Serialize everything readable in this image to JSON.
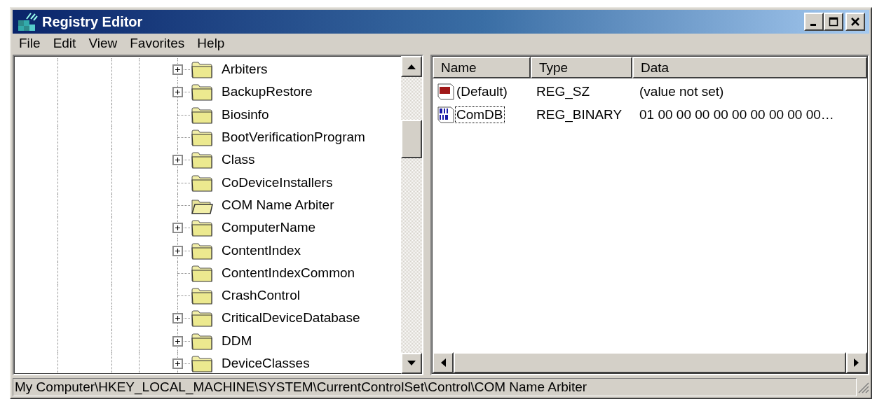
{
  "window": {
    "title": "Registry Editor"
  },
  "menu": [
    "File",
    "Edit",
    "View",
    "Favorites",
    "Help"
  ],
  "tree": {
    "items": [
      {
        "label": "Arbiters",
        "expandable": true,
        "open": false
      },
      {
        "label": "BackupRestore",
        "expandable": true,
        "open": false
      },
      {
        "label": "Biosinfo",
        "expandable": false,
        "open": false
      },
      {
        "label": "BootVerificationProgram",
        "expandable": false,
        "open": false
      },
      {
        "label": "Class",
        "expandable": true,
        "open": false
      },
      {
        "label": "CoDeviceInstallers",
        "expandable": false,
        "open": false
      },
      {
        "label": "COM Name Arbiter",
        "expandable": false,
        "open": true
      },
      {
        "label": "ComputerName",
        "expandable": true,
        "open": false
      },
      {
        "label": "ContentIndex",
        "expandable": true,
        "open": false
      },
      {
        "label": "ContentIndexCommon",
        "expandable": false,
        "open": false
      },
      {
        "label": "CrashControl",
        "expandable": false,
        "open": false
      },
      {
        "label": "CriticalDeviceDatabase",
        "expandable": true,
        "open": false
      },
      {
        "label": "DDM",
        "expandable": true,
        "open": false
      },
      {
        "label": "DeviceClasses",
        "expandable": true,
        "open": false
      }
    ]
  },
  "values": {
    "columns": [
      "Name",
      "Type",
      "Data"
    ],
    "rows": [
      {
        "kind": "string",
        "name": "(Default)",
        "type": "REG_SZ",
        "data": "(value not set)",
        "focused": false
      },
      {
        "kind": "binary",
        "name": "ComDB",
        "type": "REG_BINARY",
        "data": "01 00 00 00 00 00 00 00 00 00…",
        "focused": true
      }
    ]
  },
  "status_bar": "My Computer\\HKEY_LOCAL_MACHINE\\SYSTEM\\CurrentControlSet\\Control\\COM Name Arbiter"
}
